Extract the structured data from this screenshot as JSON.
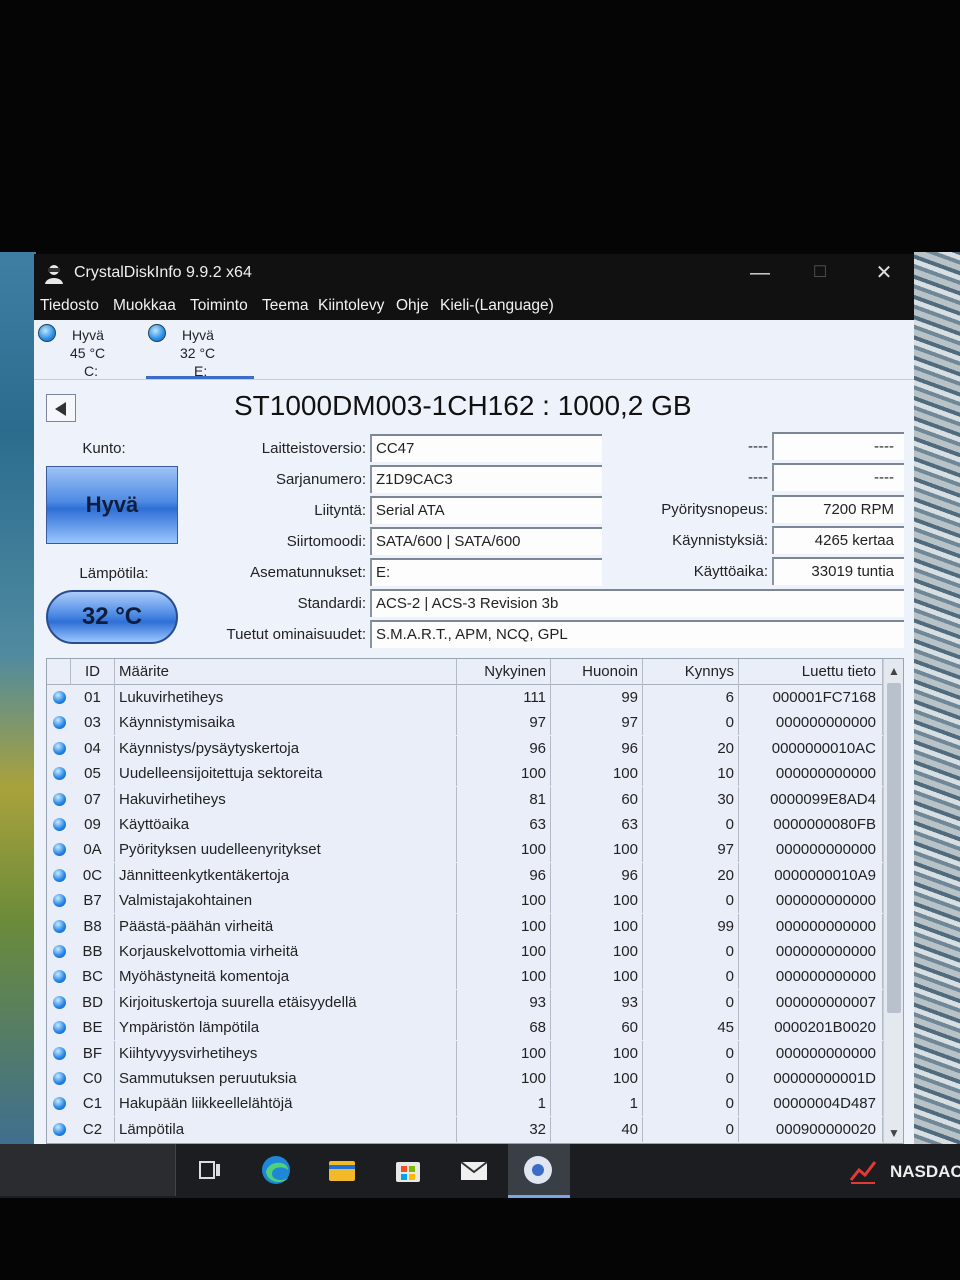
{
  "window": {
    "title": "CrystalDiskInfo 9.9.2 x64",
    "minimize_glyph": "—",
    "maximize_glyph": "☐",
    "close_glyph": "✕"
  },
  "menu": [
    "Tiedosto",
    "Muokkaa",
    "Toiminto",
    "Teema",
    "Kiintolevy",
    "Ohje",
    "Kieli-(Language)"
  ],
  "drives": [
    {
      "status": "Hyvä",
      "temp": "45 °C",
      "letter": "C:"
    },
    {
      "status": "Hyvä",
      "temp": "32 °C",
      "letter": "E:",
      "selected": true
    }
  ],
  "disk": {
    "model": "ST1000DM003-1CH162 : 1000,2 GB",
    "health_label": "Kunto:",
    "health": "Hyvä",
    "temp_label": "Lämpötila:",
    "temp": "32 °C",
    "fields": {
      "firmware_label": "Laitteistoversio:",
      "firmware": "CC47",
      "serial_label": "Sarjanumero:",
      "serial": "Z1D9CAC3",
      "interface_label": "Liityntä:",
      "interface": "Serial ATA",
      "transfer_label": "Siirtomoodi:",
      "transfer": "SATA/600 | SATA/600",
      "drive_letter_label": "Asematunnukset:",
      "drive_letter": "E:",
      "standard_label": "Standardi:",
      "standard": "ACS-2 | ACS-3 Revision 3b",
      "features_label": "Tuetut ominaisuudet:",
      "features": "S.M.A.R.T., APM, NCQ, GPL"
    },
    "right_fields": {
      "blank1_label": "----",
      "blank1": "----",
      "blank2_label": "----",
      "blank2": "----",
      "rpm_label": "Pyöritysnopeus:",
      "rpm": "7200 RPM",
      "power_count_label": "Käynnistyksiä:",
      "power_count": "4265 kertaa",
      "power_hours_label": "Käyttöaika:",
      "power_hours": "33019 tuntia"
    }
  },
  "smart": {
    "columns": [
      "ID",
      "Määrite",
      "Nykyinen",
      "Huonoin",
      "Kynnys",
      "Luettu tieto"
    ],
    "rows": [
      [
        "01",
        "Lukuvirhetiheys",
        "111",
        "99",
        "6",
        "000001FC7168"
      ],
      [
        "03",
        "Käynnistymisaika",
        "97",
        "97",
        "0",
        "000000000000"
      ],
      [
        "04",
        "Käynnistys/pysäytyskertoja",
        "96",
        "96",
        "20",
        "0000000010AC"
      ],
      [
        "05",
        "Uudelleensijoitettuja sektoreita",
        "100",
        "100",
        "10",
        "000000000000"
      ],
      [
        "07",
        "Hakuvirhetiheys",
        "81",
        "60",
        "30",
        "0000099E8AD4"
      ],
      [
        "09",
        "Käyttöaika",
        "63",
        "63",
        "0",
        "0000000080FB"
      ],
      [
        "0A",
        "Pyörityksen uudelleenyritykset",
        "100",
        "100",
        "97",
        "000000000000"
      ],
      [
        "0C",
        "Jännitteenkytkentäkertoja",
        "96",
        "96",
        "20",
        "0000000010A9"
      ],
      [
        "B7",
        "Valmistajakohtainen",
        "100",
        "100",
        "0",
        "000000000000"
      ],
      [
        "B8",
        "Päästä-päähän virheitä",
        "100",
        "100",
        "99",
        "000000000000"
      ],
      [
        "BB",
        "Korjauskelvottomia virheitä",
        "100",
        "100",
        "0",
        "000000000000"
      ],
      [
        "BC",
        "Myöhästyneitä komentoja",
        "100",
        "100",
        "0",
        "000000000000"
      ],
      [
        "BD",
        "Kirjoituskertoja suurella etäisyydellä",
        "93",
        "93",
        "0",
        "000000000007"
      ],
      [
        "BE",
        "Ympäristön lämpötila",
        "68",
        "60",
        "45",
        "0000201B0020"
      ],
      [
        "BF",
        "Kiihtyvyysvirhetiheys",
        "100",
        "100",
        "0",
        "000000000000"
      ],
      [
        "C0",
        "Sammutuksen peruutuksia",
        "100",
        "100",
        "0",
        "00000000001D"
      ],
      [
        "C1",
        "Hakupään liikkeellelähtöjä",
        "1",
        "1",
        "0",
        "00000004D487"
      ],
      [
        "C2",
        "Lämpötila",
        "32",
        "40",
        "0",
        "000900000020"
      ]
    ]
  },
  "taskbar": {
    "icons": [
      "task-view-icon",
      "edge-icon",
      "file-explorer-icon",
      "store-icon",
      "mail-icon",
      "crystaldiskinfo-icon"
    ],
    "ticker": "NASDAC"
  },
  "colors": {
    "accent": "#3b6cc7",
    "status_good": "#2f6fd6",
    "titlebar": "#111111"
  }
}
